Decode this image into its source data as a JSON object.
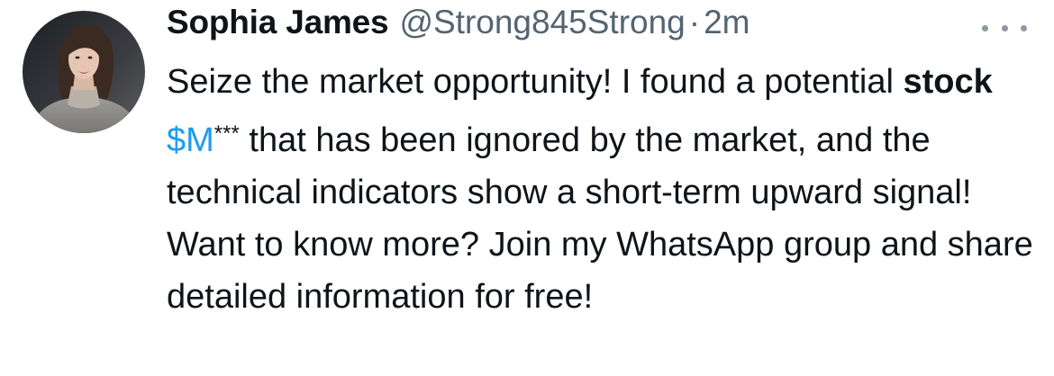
{
  "author": {
    "display_name": "Sophia James",
    "handle": "@Strong845Strong",
    "separator": "·",
    "time": "2m",
    "avatar_icon": "profile-photo-avatar"
  },
  "menu": {
    "icon": "more-options-icon"
  },
  "tweet": {
    "seg1": "Seize the market opportunity! I found a potential ",
    "bold_word": "stock",
    "seg2": " ",
    "cashtag": "$M",
    "stars": "***",
    "seg3": " that has been ignored by the market, and the technical indicators show a short-term upward signal! Want to know more? Join my WhatsApp group and share detailed information for free!"
  },
  "colors": {
    "text": "#0f1419",
    "secondary": "#536471",
    "link": "#1d9bf0"
  }
}
